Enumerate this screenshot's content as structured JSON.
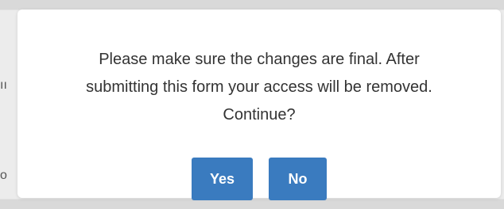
{
  "background": {
    "fragments": [
      "ıı",
      "o"
    ]
  },
  "modal": {
    "message_lines": [
      "Please make sure the changes are final. After",
      "submitting this form your access will be removed.",
      "Continue?"
    ],
    "buttons": {
      "yes_label": "Yes",
      "no_label": "No"
    }
  },
  "colors": {
    "button_primary": "#3a7bbf",
    "overlay": "#d9d9d9",
    "modal_bg": "#ffffff",
    "message_text": "#333333"
  }
}
